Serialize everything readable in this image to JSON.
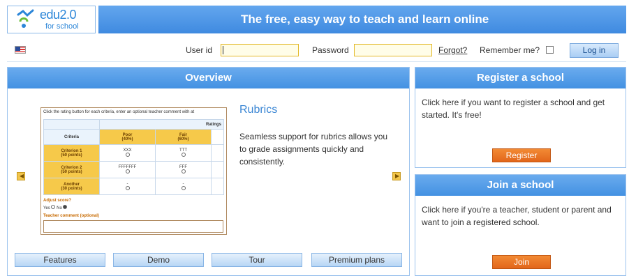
{
  "header": {
    "logo_text": "edu2.0",
    "logo_sub": "for school",
    "tagline": "The free, easy way to teach and learn online"
  },
  "login": {
    "flag_icon": "us-flag-icon",
    "user_label": "User id",
    "password_label": "Password",
    "forgot_link": "Forgot?",
    "remember_label": "Remember me?",
    "login_button": "Log in"
  },
  "overview": {
    "title": "Overview",
    "prev_icon": "arrow-left-icon",
    "next_icon": "arrow-right-icon",
    "feature_title": "Rubrics",
    "feature_desc": "Seamless support for rubrics allows you to grade assignments quickly and consistently.",
    "rubric": {
      "instruction": "Click the rating button for each criteria, enter an optional teacher comment with at",
      "ratings_label": "Ratings",
      "criteria_label": "Criteria",
      "columns": [
        "Poor\n(40%)",
        "Fair\n(60%)"
      ],
      "rows": [
        {
          "label": "Criterion 1\n(50 points)",
          "cells": [
            "XXX",
            "TTT"
          ]
        },
        {
          "label": "Criterion 2\n(50 points)",
          "cells": [
            "FFFFFFF",
            "FFF"
          ]
        },
        {
          "label": "Another\n(30 points)",
          "cells": [
            "-",
            "-"
          ]
        }
      ],
      "adjust_label": "Adjust score?",
      "yes_label": "Yes",
      "no_label": "No",
      "comment_label": "Teacher comment (optional)"
    },
    "tabs": [
      "Features",
      "Demo",
      "Tour",
      "Premium plans"
    ]
  },
  "register": {
    "title": "Register a school",
    "desc": "Click here if you want to register a school and get started. It's free!",
    "button": "Register"
  },
  "join": {
    "title": "Join a school",
    "desc": "Click here if you're a teacher, student or parent and want to join a registered school.",
    "button": "Join"
  }
}
